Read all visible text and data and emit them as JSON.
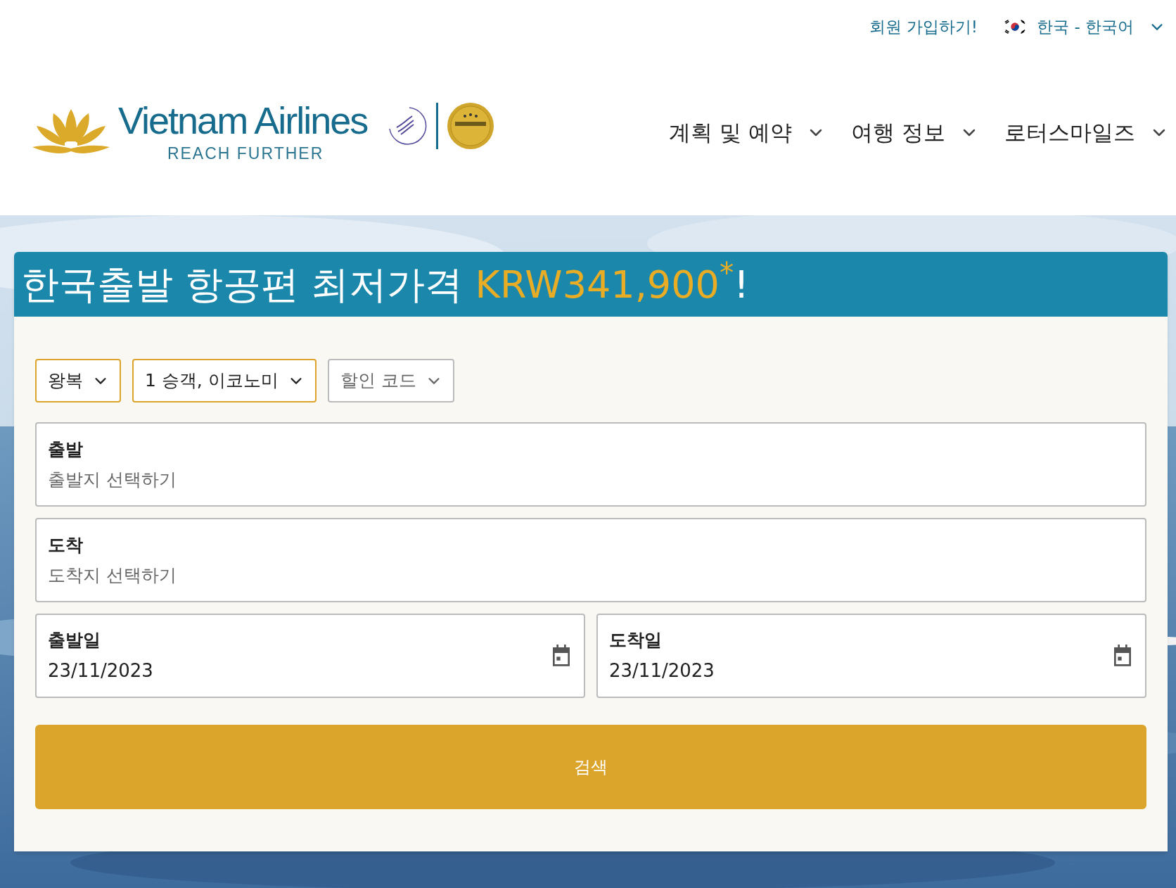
{
  "top_bar": {
    "signup_link": "회원 가입하기!",
    "language": "한국 - 한국어"
  },
  "logo": {
    "name": "Vietnam Airlines",
    "tagline": "REACH FURTHER"
  },
  "nav": [
    {
      "label": "계획 및 예약"
    },
    {
      "label": "여행 정보"
    },
    {
      "label": "로터스마일즈"
    }
  ],
  "booking": {
    "headline": "한국출발 항공편 최저가격",
    "price": "KRW341,900$^{*}$",
    "suffix": "!",
    "options": [
      {
        "label": "왕복",
        "highlighted": true
      },
      {
        "label": "1 승객, 이코노미",
        "highlighted": true
      },
      {
        "label": "할인 코드",
        "highlighted": false
      }
    ],
    "from": {
      "label": "출발",
      "placeholder": "출발지 선택하기"
    },
    "to": {
      "label": "도착",
      "placeholder": "도착지 선택하기"
    },
    "dates": [
      {
        "label": "출발일",
        "value": "23/11/2023"
      },
      {
        "label": "도착일",
        "value": "23/11/2023"
      }
    ],
    "search_button": "검색"
  }
}
